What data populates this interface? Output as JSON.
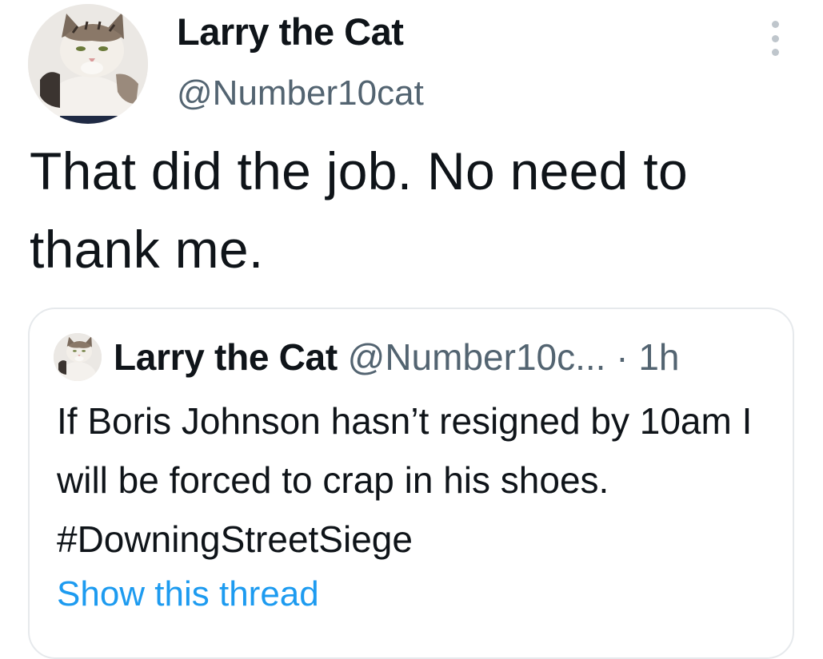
{
  "tweet": {
    "author": {
      "display_name": "Larry the Cat",
      "handle": "@Number10cat",
      "avatar_icon": "cat-avatar"
    },
    "more_icon": "more-vertical-icon",
    "text": "That did the job. No need to thank me."
  },
  "quoted_tweet": {
    "author": {
      "display_name": "Larry the Cat",
      "handle": "@Number10c...",
      "avatar_icon": "cat-avatar"
    },
    "separator": "·",
    "time": "1h",
    "text": "If Boris Johnson hasn’t resigned by 10am I will be forced to crap in his shoes. #DowningStreetSiege",
    "show_thread_label": "Show this thread"
  },
  "colors": {
    "text_primary": "#0f1419",
    "text_secondary": "#536471",
    "link": "#1d9bf0",
    "border": "#e6e9ec"
  }
}
